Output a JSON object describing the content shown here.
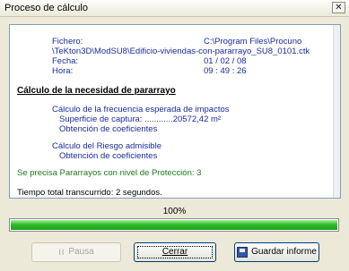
{
  "window": {
    "title": "Proceso de cálculo",
    "close_glyph": "✕"
  },
  "report": {
    "fichero_label": "Fichero:",
    "fichero_value_line1": "C:\\Program Files\\Procuno",
    "fichero_value_line2": "\\TeKton3D\\ModSU8\\Edificio-viviendas-con-pararrayo_SU8_0101.ctk",
    "fecha_label": "Fecha:",
    "fecha_value": "01 / 02 / 08",
    "hora_label": "Hora:",
    "hora_value": "09 : 49 : 26",
    "heading": "Cálculo de la necesidad de pararrayo",
    "freq_title": "Cálculo de la frecuencia esperada de impactos",
    "superficie": "Superficie de captura: ............20572,42 m²",
    "obtencion1": "Obtención de coeficientes",
    "riesgo_title": "Cálculo del Riesgo admisible",
    "obtencion2": "Obtención de coeficientes",
    "result": "Se precisa Pararrayos con nivel de Protección: 3",
    "tiempo": "Tiempo total transcurrido: 2 segundos."
  },
  "progress": {
    "label": "100%",
    "value": 1.0
  },
  "buttons": {
    "pausa": "Pausa",
    "cerrar": "Cerrar",
    "guardar": "Guardar informe"
  },
  "colors": {
    "report_blue": "#1a2b9c",
    "result_green": "#1a7a1a",
    "progress_green": "#2fbf2a"
  },
  "icons": {
    "pausa": "pause-icon",
    "guardar": "floppy-disk-icon",
    "close": "close-icon"
  }
}
